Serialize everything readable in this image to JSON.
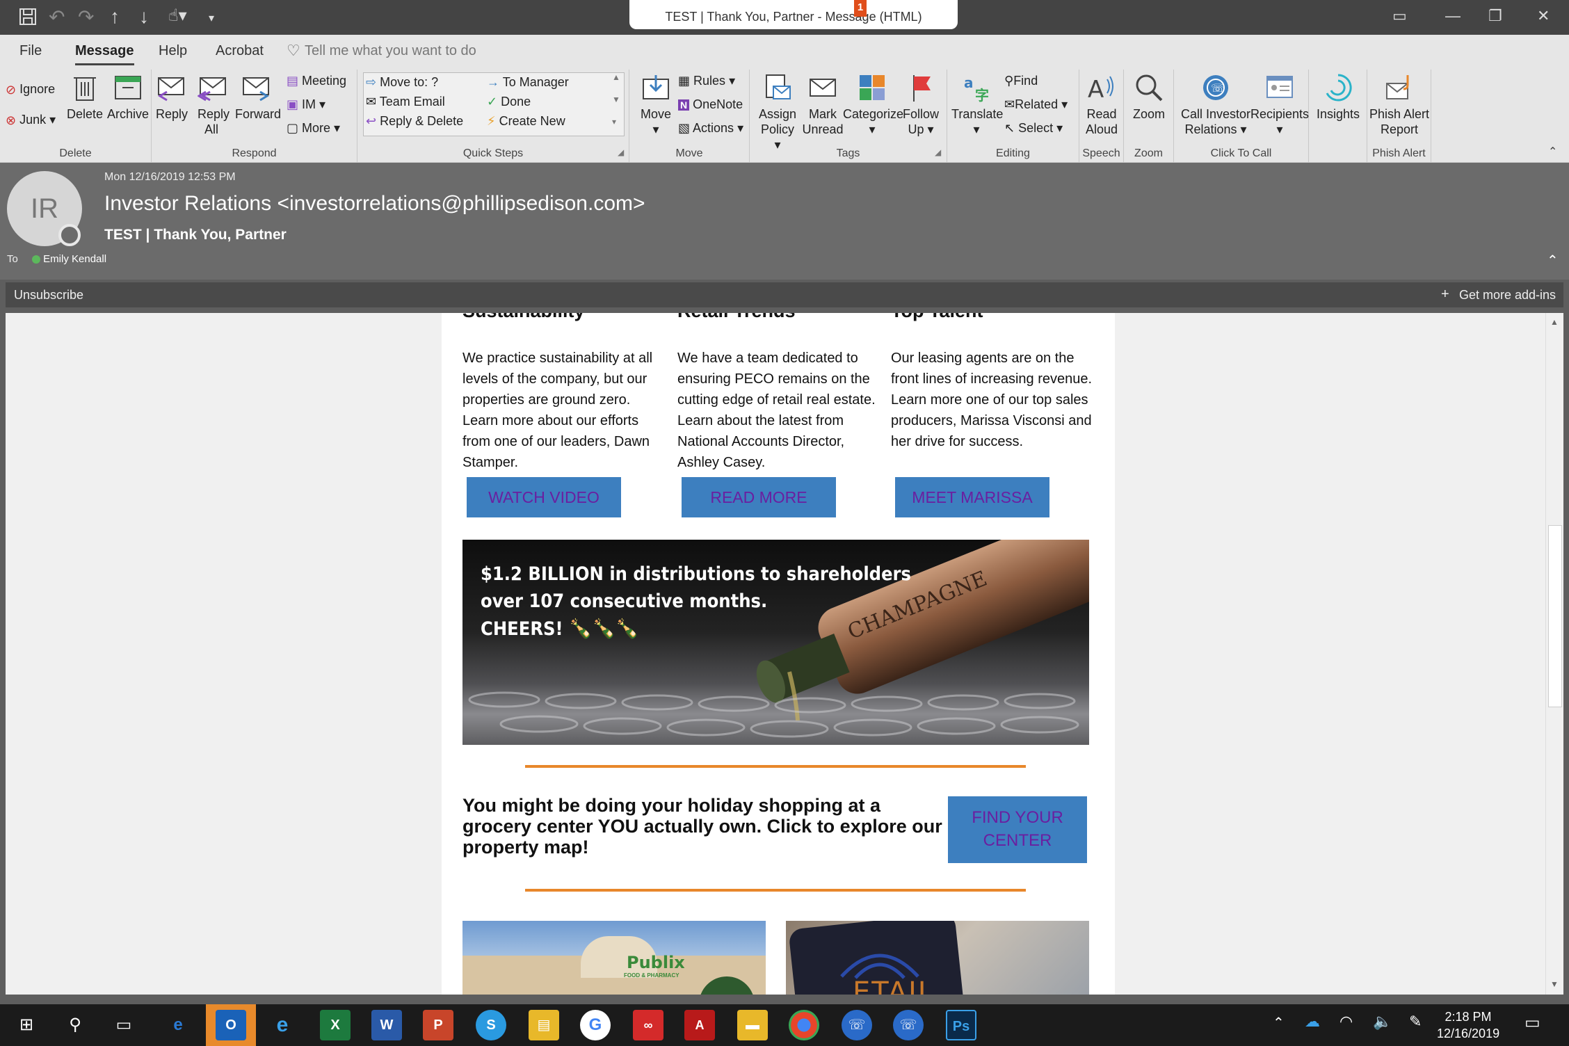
{
  "window": {
    "title": "TEST | Thank You, Partner  -  Message (HTML)",
    "notification_count": "1"
  },
  "menu": {
    "file": "File",
    "message": "Message",
    "help": "Help",
    "acrobat": "Acrobat",
    "tell_me": "Tell me what you want to do"
  },
  "ribbon": {
    "delete_group": {
      "label": "Delete",
      "ignore": "Ignore",
      "junk": "Junk",
      "delete": "Delete",
      "archive": "Archive"
    },
    "respond_group": {
      "label": "Respond",
      "reply": "Reply",
      "reply_all_1": "Reply",
      "reply_all_2": "All",
      "forward": "Forward",
      "meeting": "Meeting",
      "im": "IM",
      "more": "More"
    },
    "quick_steps_group": {
      "label": "Quick Steps",
      "move_to": "Move to: ?",
      "team_email": "Team Email",
      "reply_delete": "Reply & Delete",
      "to_manager": "To Manager",
      "done": "Done",
      "create_new": "Create New"
    },
    "move_group": {
      "label": "Move",
      "move": "Move",
      "rules": "Rules",
      "onenote": "OneNote",
      "actions": "Actions"
    },
    "tags_group": {
      "label": "Tags",
      "assign_1": "Assign",
      "assign_2": "Policy",
      "mark_1": "Mark",
      "mark_2": "Unread",
      "categorize": "Categorize",
      "follow_1": "Follow",
      "follow_2": "Up"
    },
    "editing_group": {
      "label": "Editing",
      "translate": "Translate",
      "find": "Find",
      "related": "Related",
      "select": "Select"
    },
    "speech_group": {
      "label": "Speech",
      "read_1": "Read",
      "read_2": "Aloud"
    },
    "zoom_group": {
      "label": "Zoom",
      "zoom": "Zoom"
    },
    "click_to_call_group": {
      "label": "Click To Call",
      "call_1": "Call",
      "call_2": "Relations",
      "investor": "Investor",
      "recipients": "Recipients",
      "insights": "Insights"
    },
    "phish_group": {
      "label": "Phish Alert",
      "phish_1": "Phish Alert",
      "phish_2": "Report"
    }
  },
  "message": {
    "date": "Mon 12/16/2019 12:53 PM",
    "avatar_initials": "IR",
    "sender": "Investor Relations <investorrelations@phillipsedison.com>",
    "subject": "TEST | Thank You, Partner",
    "to_label": "To",
    "recipient": "Emily Kendall",
    "unsubscribe": "Unsubscribe",
    "get_addins": "Get more add-ins"
  },
  "email": {
    "columns": [
      {
        "heading": "Sustainability",
        "text": "We practice sustainability at all levels of the company, but our properties are ground zero. Learn more about our efforts from one of our leaders, Dawn Stamper.",
        "button": "WATCH VIDEO"
      },
      {
        "heading": "Retail Trends",
        "text": "We have a team dedicated to ensuring PECO remains on the cutting edge of retail real estate. Learn about the latest from National Accounts Director, Ashley Casey.",
        "button": "READ MORE"
      },
      {
        "heading": "Top Talent",
        "text": "Our leasing agents are on the front lines of increasing revenue. Learn more one of our top sales producers, Marissa Visconsi and her drive for success.",
        "button": "MEET MARISSA"
      }
    ],
    "banner": {
      "line1": "$1.2 BILLION in distributions to shareholders",
      "line2": "over 107 consecutive months.",
      "line3": "CHEERS! 🍾🍾🍾",
      "bottle_label": "CHAMPAGNE"
    },
    "promo_text": "You might be doing your holiday shopping at a grocery center YOU actually own. Click to explore our property map!",
    "find_button_1": "FIND YOUR",
    "find_button_2": "CENTER",
    "store_sign": "Publix",
    "store_sub": "FOOD & PHARMACY",
    "phone_text": "ETAIL"
  },
  "taskbar": {
    "time": "2:18 PM",
    "date": "12/16/2019",
    "apps": [
      "Outlook",
      "Internet Explorer",
      "Excel",
      "Word",
      "PowerPoint",
      "Skype",
      "File Explorer",
      "Google",
      "Creative Cloud",
      "Acrobat",
      "Folder",
      "Chrome",
      "Click To Call",
      "Call",
      "Photoshop"
    ]
  },
  "colors": {
    "accent_button": "#3d7fbf",
    "button_text": "#6a1fa0",
    "rule_orange": "#e8872b",
    "ribbon_bg": "#e6e6e6"
  }
}
